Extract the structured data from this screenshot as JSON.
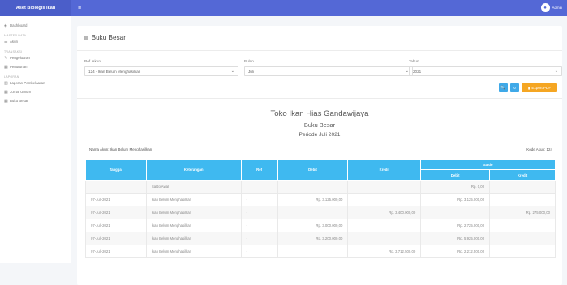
{
  "app": {
    "brand": "Aset Biologis Ikan",
    "user": "Admin"
  },
  "sidebar": {
    "items": [
      {
        "type": "item",
        "icon": "dashboard-icon",
        "glyph": "◈",
        "label": "Dashboard"
      },
      {
        "type": "head",
        "label": "MASTER DATA"
      },
      {
        "type": "item",
        "icon": "list-icon",
        "glyph": "☰",
        "label": "Akun"
      },
      {
        "type": "head",
        "label": "TRANSAKSI"
      },
      {
        "type": "item",
        "icon": "fish-icon",
        "glyph": "✎",
        "label": "Pengeluaran"
      },
      {
        "type": "item",
        "icon": "table-icon",
        "glyph": "▦",
        "label": "Penurunan"
      },
      {
        "type": "head",
        "label": "LAPORAN"
      },
      {
        "type": "item",
        "icon": "chart-icon",
        "glyph": "▥",
        "label": "Laporan Pembelaaran"
      },
      {
        "type": "item",
        "icon": "table-icon",
        "glyph": "▦",
        "label": "Jurnal Umum"
      },
      {
        "type": "item",
        "icon": "table-icon",
        "glyph": "▦",
        "label": "Buku Besar"
      }
    ]
  },
  "page": {
    "title": "Buku Besar"
  },
  "filters": {
    "akun_label": "Ref. Akun",
    "akun_value": "124 - Ikan Belum Menghasilkan",
    "bulan_label": "Bulan",
    "bulan_value": "Juli",
    "tahun_label": "Tahun",
    "tahun_value": "2021"
  },
  "buttons": {
    "search_icon": "🔍",
    "refresh_icon": "↻",
    "export_label": "Export PDF"
  },
  "report": {
    "company": "Toko Ikan Hias Gandawijaya",
    "name": "Buku Besar",
    "period": "Periode Juli 2021",
    "account_name": "Nama Akun: Ikan Belum Menghasilkan",
    "account_code": "Kode Akun: 124"
  },
  "table": {
    "headers": {
      "tanggal": "Tanggal",
      "keterangan": "Keterangan",
      "ref": "Ref",
      "debit": "Debit",
      "kredit": "Kredit",
      "saldo": "Saldo",
      "saldo_debit": "Debit",
      "saldo_kredit": "Kredit"
    },
    "rows": [
      [
        "",
        "Saldo Awal",
        "",
        "",
        "",
        "Rp. 0,00",
        ""
      ],
      [
        "07-Juli-2021",
        "Ikan Belum Menghasilkan",
        "-",
        "Rp. 3.125.000,00",
        "",
        "Rp. 3.125.000,00",
        ""
      ],
      [
        "07-Juli-2021",
        "Ikan Belum Menghasilkan",
        "-",
        "",
        "Rp. 3.400.000,00",
        "",
        "Rp. 275.000,00"
      ],
      [
        "07-Juli-2021",
        "Ikan Belum Menghasilkan",
        "-",
        "Rp. 3.000.000,00",
        "",
        "Rp. 2.725.000,00",
        ""
      ],
      [
        "07-Juli-2021",
        "Ikan Belum Menghasilkan",
        "-",
        "Rp. 3.200.000,00",
        "",
        "Rp. 5.925.000,00",
        ""
      ],
      [
        "07-Juli-2021",
        "Ikan Belum Menghasilkan",
        "-",
        "",
        "Rp. 3.712.500,00",
        "Rp. 2.212.500,00",
        ""
      ]
    ]
  }
}
